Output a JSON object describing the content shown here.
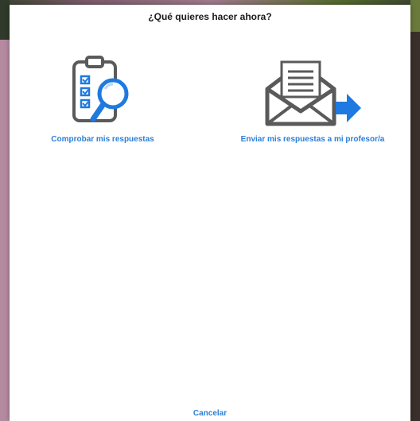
{
  "dialog": {
    "title": "¿Qué quieres hacer ahora?",
    "options": [
      {
        "label": "Comprobar mis respuestas",
        "icon": "clipboard-magnifier-icon"
      },
      {
        "label": "Enviar mis respuestas a mi profesor/a",
        "icon": "envelope-send-icon"
      }
    ],
    "cancel_label": "Cancelar"
  },
  "colors": {
    "accent": "#2a7fd8",
    "icon_gray": "#5a5a5a",
    "icon_blue": "#1e7ae0"
  }
}
